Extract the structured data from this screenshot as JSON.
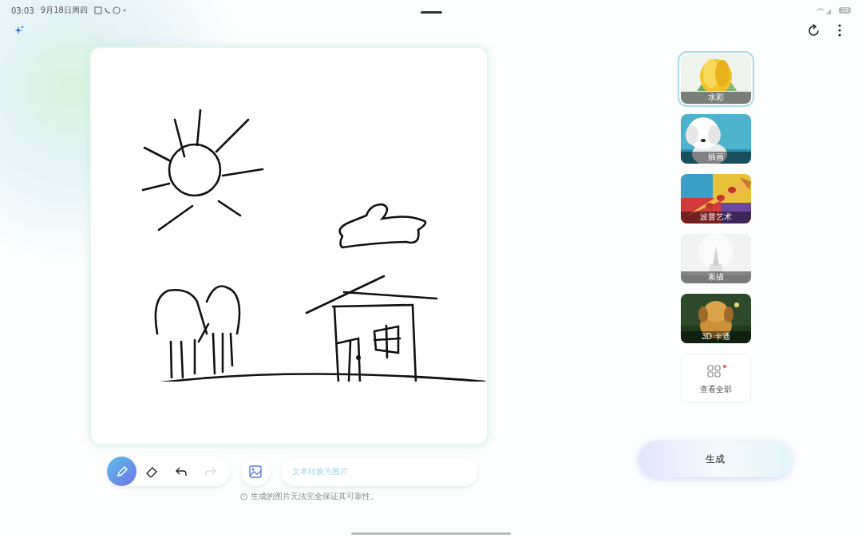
{
  "status_bar": {
    "time": "03:03",
    "date": "9月18日周四",
    "battery": "19"
  },
  "styles": [
    {
      "label": "水彩",
      "selected": true
    },
    {
      "label": "插画",
      "selected": false
    },
    {
      "label": "波普艺术",
      "selected": false
    },
    {
      "label": "素描",
      "selected": false
    },
    {
      "label": "3D 卡通",
      "selected": false
    }
  ],
  "view_all": {
    "label": "查看全部",
    "badge": true
  },
  "tools": [
    {
      "kind": "pencil",
      "selected": true,
      "disabled": false
    },
    {
      "kind": "eraser",
      "selected": false,
      "disabled": false
    },
    {
      "kind": "undo",
      "selected": false,
      "disabled": false
    },
    {
      "kind": "redo",
      "selected": false,
      "disabled": true
    }
  ],
  "prompt": {
    "placeholder": "文本转换为图片"
  },
  "notice": "生成的图片无法完全保证其可靠性。",
  "generate_button": "生成"
}
